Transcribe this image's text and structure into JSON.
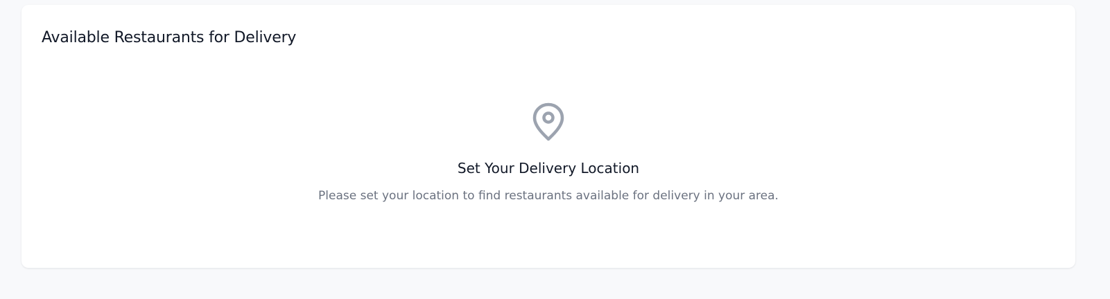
{
  "section": {
    "title": "Available Restaurants for Delivery"
  },
  "empty_state": {
    "icon": "map-pin-icon",
    "title": "Set Your Delivery Location",
    "description": "Please set your location to find restaurants available for delivery in your area."
  },
  "colors": {
    "page_background": "#f8f9fb",
    "card_background": "#ffffff",
    "heading_text": "#111827",
    "muted_text": "#6b7280",
    "icon": "#9ca3af"
  }
}
